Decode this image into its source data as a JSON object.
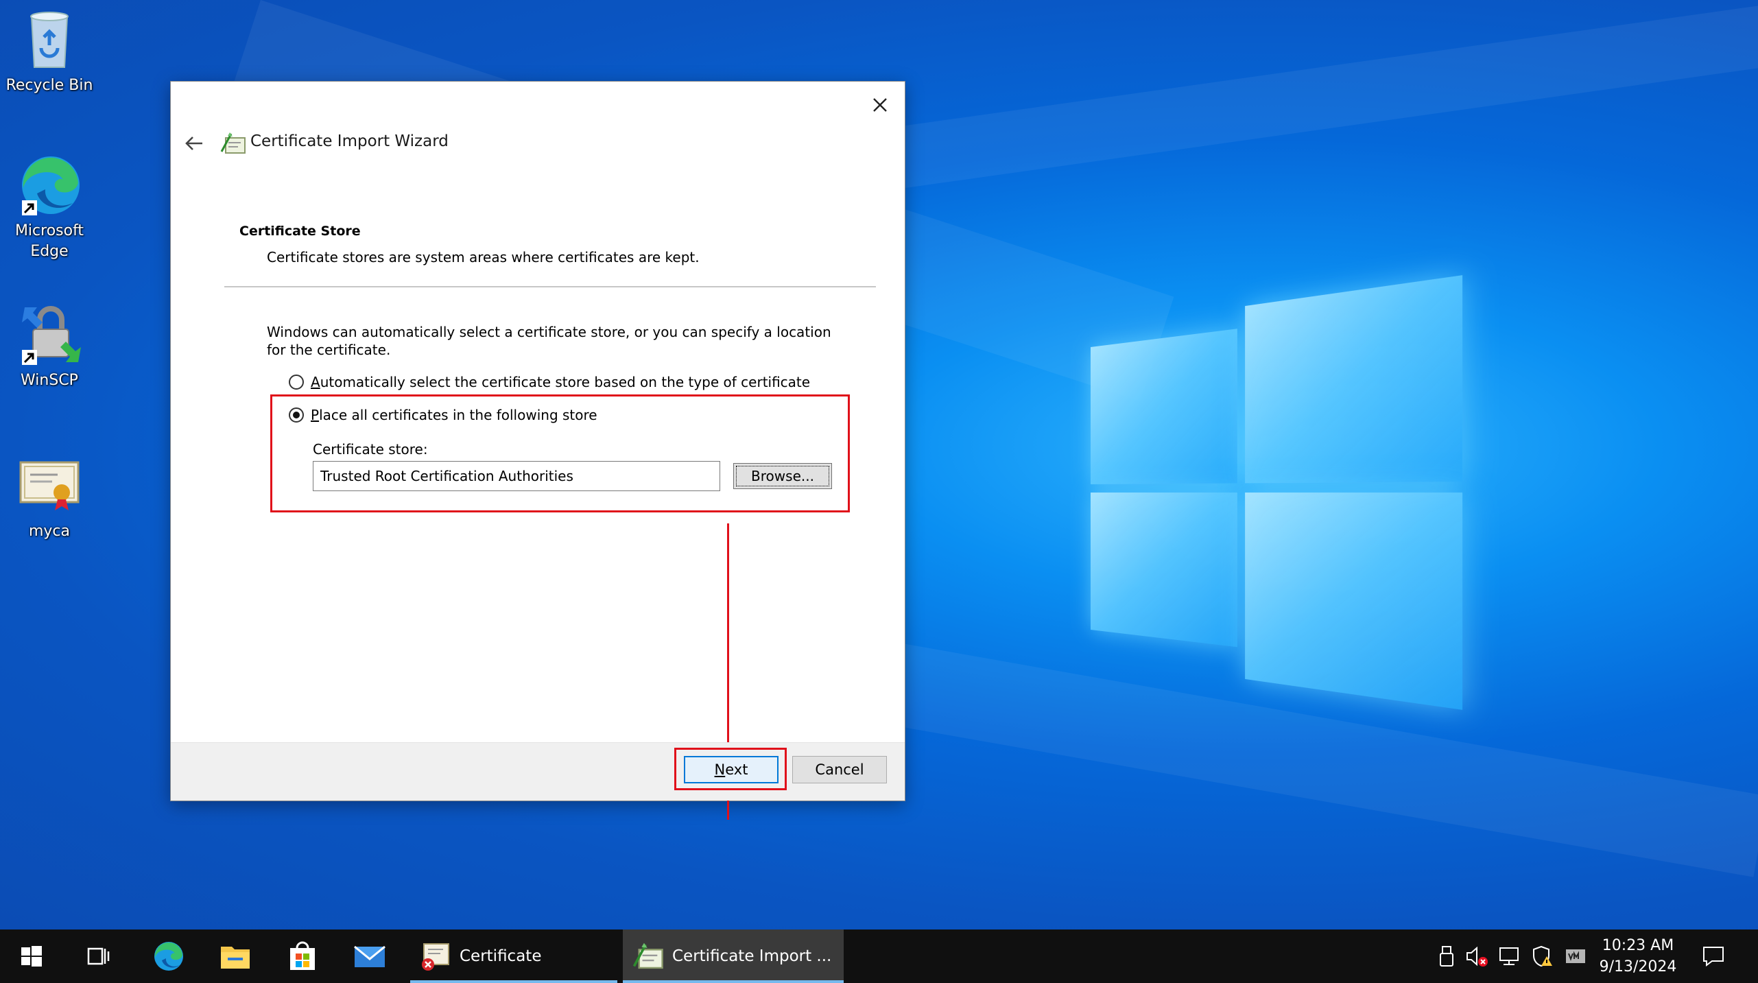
{
  "desktop": {
    "icons": [
      {
        "label": "Recycle Bin",
        "icon": "recycle-bin-icon"
      },
      {
        "label": "Microsoft Edge",
        "icon": "edge-icon"
      },
      {
        "label": "WinSCP",
        "icon": "winscp-icon"
      },
      {
        "label": "myca",
        "icon": "certificate-file-icon"
      }
    ]
  },
  "dialog": {
    "title": "Certificate Import Wizard",
    "section_title": "Certificate Store",
    "section_desc": "Certificate stores are system areas where certificates are kept.",
    "intro": "Windows can automatically select a certificate store, or you can specify a location for the certificate.",
    "radio_auto": {
      "label_accel": "A",
      "label_rest": "utomatically select the certificate store based on the type of certificate",
      "checked": false
    },
    "radio_place": {
      "label_accel": "P",
      "label_rest": "lace all certificates in the following store",
      "checked": true
    },
    "store_label": "Certificate store:",
    "store_value": "Trusted Root Certification Authorities",
    "browse_label": "Browse...",
    "next": {
      "accel": "N",
      "rest": "ext"
    },
    "cancel_label": "Cancel"
  },
  "taskbar": {
    "apps": [
      {
        "label": "Certificate",
        "icon": "certificate-error-icon"
      },
      {
        "label": "Certificate Import ...",
        "icon": "certificate-wizard-icon"
      }
    ],
    "time": "10:23 AM",
    "date": "9/13/2024"
  },
  "colors": {
    "highlight": "#e0101a",
    "accent": "#0078d7",
    "taskbar": "#101010"
  }
}
